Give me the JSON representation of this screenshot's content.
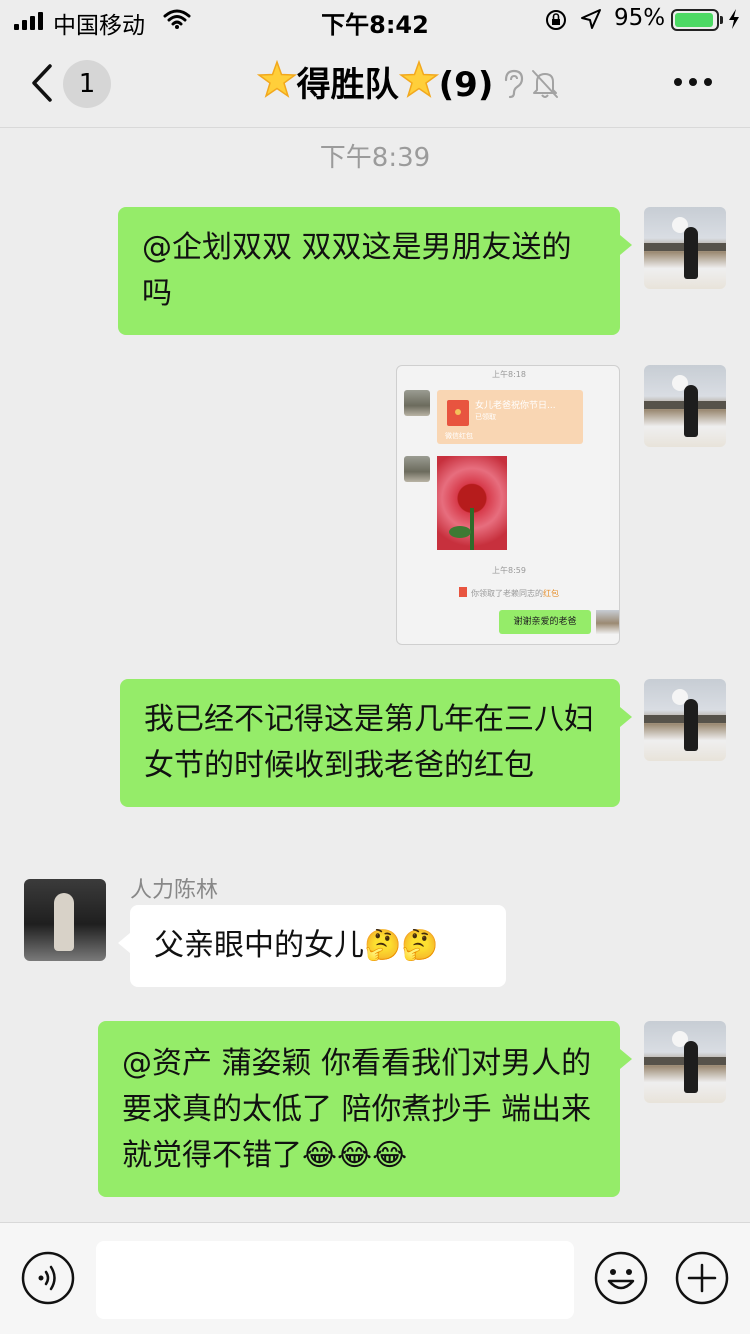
{
  "status_bar": {
    "carrier": "中国移动",
    "time": "下午8:42",
    "battery_percent": "95%",
    "battery_level": 0.95,
    "icons": [
      "signal-icon",
      "wifi-icon",
      "rotation-lock-icon",
      "location-arrow-icon",
      "battery-icon",
      "charging-bolt-icon"
    ]
  },
  "nav": {
    "unread_count": "1",
    "title": "得胜队",
    "member_count": "(9)",
    "icons": [
      "back-chevron-icon",
      "star-icon",
      "ear-icon",
      "muted-bell-icon",
      "more-icon"
    ]
  },
  "chat": {
    "timestamp": "下午8:39",
    "messages": [
      {
        "type": "text",
        "from": "self",
        "text": "@企划双双 双双这是男朋友送的吗"
      },
      {
        "type": "image",
        "from": "self"
      },
      {
        "type": "text",
        "from": "self",
        "text": "我已经不记得这是第几年在三八妇女节的时候收到我老爸的红包"
      },
      {
        "type": "text",
        "from": "other",
        "sender": "人力陈林",
        "text": "父亲眼中的女儿🤔🤔"
      },
      {
        "type": "text",
        "from": "self",
        "text": "@资产 蒲姿颖 你看看我们对男人的要求真的太低了  陪你煮抄手  端出来  就觉得不错了😂😂😂"
      }
    ],
    "image_content": {
      "time1": "上午8:18",
      "red_packet_title": "女儿老爸祝你节日...",
      "red_packet_status": "已领取",
      "red_packet_label": "微信红包",
      "time2": "上午8:59",
      "notice_text": "你领取了老赖同志的",
      "notice_link": "红包",
      "reply": "谢谢亲爱的老爸"
    }
  },
  "input_bar": {
    "value": "",
    "placeholder": "",
    "icons": [
      "voice-icon",
      "emoji-icon",
      "plus-icon"
    ]
  },
  "colors": {
    "self_bubble": "#95ec69",
    "other_bubble": "#ffffff",
    "background": "#ededed",
    "battery_fill": "#4cd964"
  }
}
